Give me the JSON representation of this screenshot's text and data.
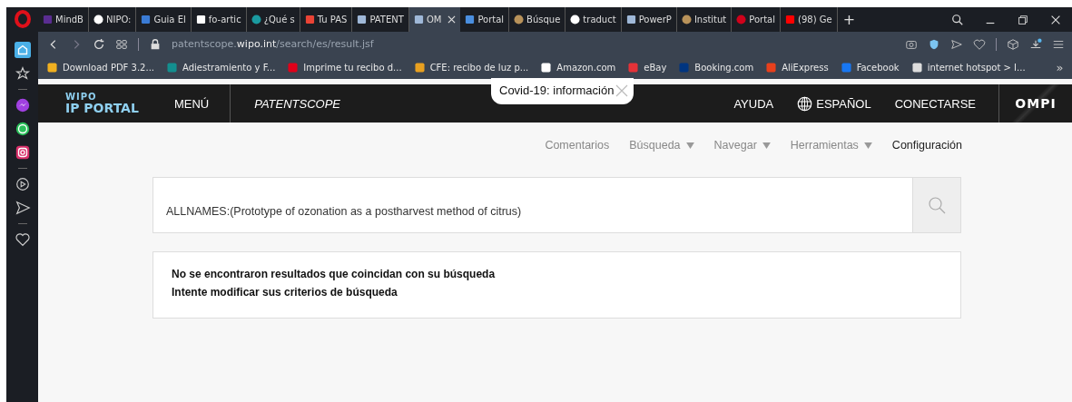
{
  "tabs": [
    {
      "label": "MindB",
      "selected": false
    },
    {
      "label": "NIPO:",
      "selected": false
    },
    {
      "label": "Guia El",
      "selected": false
    },
    {
      "label": "fo-artic",
      "selected": false
    },
    {
      "label": "¿Qué s",
      "selected": false
    },
    {
      "label": "Tu PAS",
      "selected": false
    },
    {
      "label": "PATENT",
      "selected": false
    },
    {
      "label": "OM",
      "selected": true
    },
    {
      "label": "Portal",
      "selected": false
    },
    {
      "label": "Búsque",
      "selected": false
    },
    {
      "label": "traduct",
      "selected": false
    },
    {
      "label": "PowerP",
      "selected": false
    },
    {
      "label": "Institut",
      "selected": false
    },
    {
      "label": "Portal",
      "selected": false
    },
    {
      "label": "(98) Ge",
      "selected": false
    }
  ],
  "new_tab": "+",
  "address": {
    "host_pre": "patentscope.",
    "host": "wipo.int",
    "path": "/search/es/result.jsf"
  },
  "bookmarks": [
    {
      "label": "Download PDF 3.2...",
      "color": "#f0b020"
    },
    {
      "label": "Adiestramiento y F...",
      "color": "#138f8f"
    },
    {
      "label": "Imprime tu recibo d...",
      "color": "#e0001a"
    },
    {
      "label": "CFE: recibo de luz p...",
      "color": "#e8a020"
    },
    {
      "label": "Amazon.com",
      "color": "#ffffff"
    },
    {
      "label": "eBay",
      "color": "#e53238"
    },
    {
      "label": "Booking.com",
      "color": "#003580"
    },
    {
      "label": "AliExpress",
      "color": "#e8401c"
    },
    {
      "label": "Facebook",
      "color": "#1877f2"
    },
    {
      "label": "internet hotspot > I...",
      "color": "#dddddd"
    }
  ],
  "bookmarks_more": "»",
  "site": {
    "logo_top": "WIPO",
    "logo_bottom": "IP PORTAL",
    "menu": "MENÚ",
    "product": "PATENTSCOPE",
    "covid": "Covid-19: información",
    "links": [
      "AYUDA",
      "ESPAÑOL",
      "CONECTARSE"
    ],
    "brand": "OMPI"
  },
  "subnav": [
    {
      "label": "Comentarios",
      "dropdown": false,
      "active": false
    },
    {
      "label": "Búsqueda",
      "dropdown": true,
      "active": false
    },
    {
      "label": "Navegar",
      "dropdown": true,
      "active": false
    },
    {
      "label": "Herramientas",
      "dropdown": true,
      "active": false
    },
    {
      "label": "Configuración",
      "dropdown": false,
      "active": true
    }
  ],
  "search": {
    "value": "ALLNAMES:(Prototype of ozonation as a postharvest method of citrus)"
  },
  "messages": [
    "No se encontraron resultados que coincidan con su búsqueda",
    "Intente modificar sus criterios de búsqueda"
  ]
}
